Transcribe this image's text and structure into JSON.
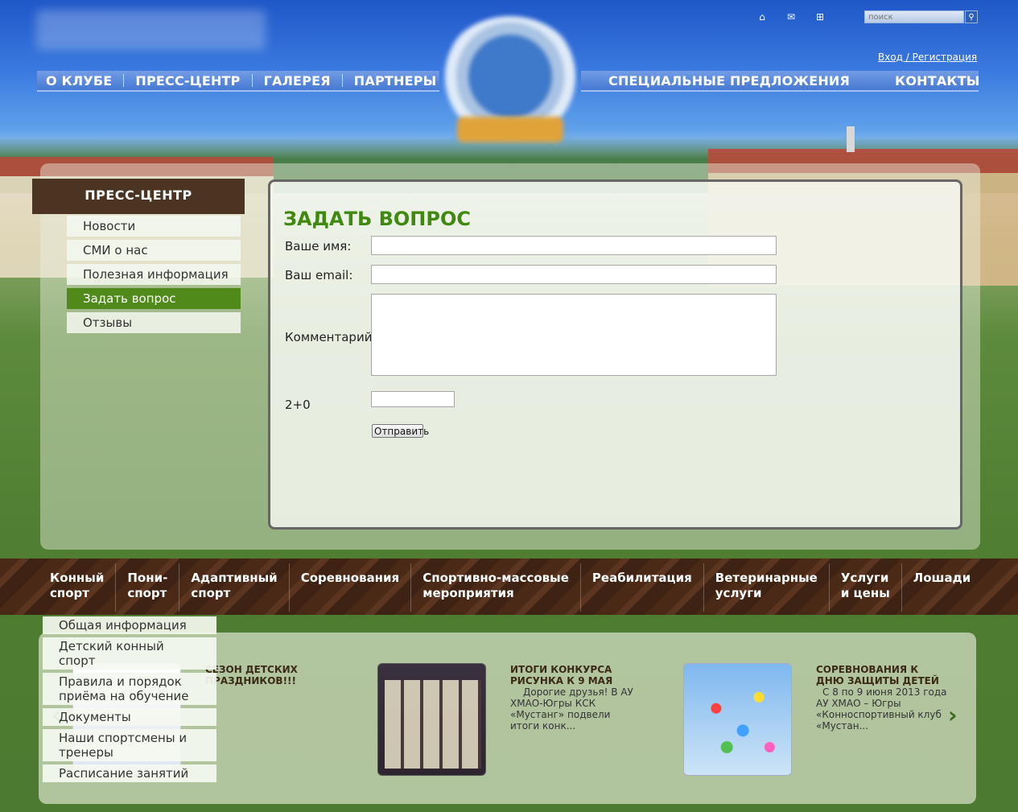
{
  "header": {
    "login_link": "Вход / Регистрация",
    "search_placeholder": "поиск",
    "icons": [
      "home-icon",
      "mail-icon",
      "sitemap-icon"
    ],
    "nav_left": [
      "О КЛУБЕ",
      "ПРЕСС-ЦЕНТР",
      "ГАЛЕРЕЯ",
      "ПАРТНЕРЫ"
    ],
    "nav_right": [
      "СПЕЦИАЛЬНЫЕ ПРЕДЛОЖЕНИЯ",
      "КОНТАКТЫ"
    ]
  },
  "sidebar": {
    "title": "ПРЕСС-ЦЕНТР",
    "items": [
      {
        "label": "Новости"
      },
      {
        "label": "СМИ о нас"
      },
      {
        "label": "Полезная информация"
      },
      {
        "label": "Задать вопрос",
        "active": true
      },
      {
        "label": "Отзывы"
      }
    ]
  },
  "form": {
    "title": "ЗАДАТЬ ВОПРОС",
    "name_label": "Ваше имя:",
    "email_label": "Ваш email:",
    "comment_label": "Комментарий:",
    "captcha_label": "2+0",
    "submit_label": "Отправить"
  },
  "bottom_nav": [
    "Конный\nспорт",
    "Пони-\nспорт",
    "Адаптивный\nспорт",
    "Соревнования",
    "Спортивно-массовые\nмероприятия",
    "Реабилитация",
    "Ветеринарные\nуслуги",
    "Услуги\nи цены",
    "Лошади"
  ],
  "dropdown": [
    "Общая информация",
    "Детский конный спорт",
    "Правила и порядок приёма на обучение",
    "Документы",
    "Наши спортсмены и тренеры",
    "Расписание занятий"
  ],
  "news": [
    {
      "title": "СЕЗОН ДЕТСКИХ ПРАЗДНИКОВ!!!",
      "text": ""
    },
    {
      "title": "ИТОГИ КОНКУРСА РИСУНКА К 9 МАЯ",
      "text": "Дорогие друзья! В АУ ХМАО-Югры КСК «Мустанг» подвели итоги конк..."
    },
    {
      "title": "СОРЕВНОВАНИЯ К ДНЮ ЗАЩИТЫ ДЕТЕЙ",
      "text": "С 8 по 9 июня 2013 года АУ ХМАО – Югры «Конноспортивный клуб «Мустан..."
    }
  ],
  "colors": {
    "accent_green": "#3f8a0e",
    "active_menu": "#4f8a1b",
    "brown": "#4b3421",
    "nav_blue": "#4f82d8"
  }
}
